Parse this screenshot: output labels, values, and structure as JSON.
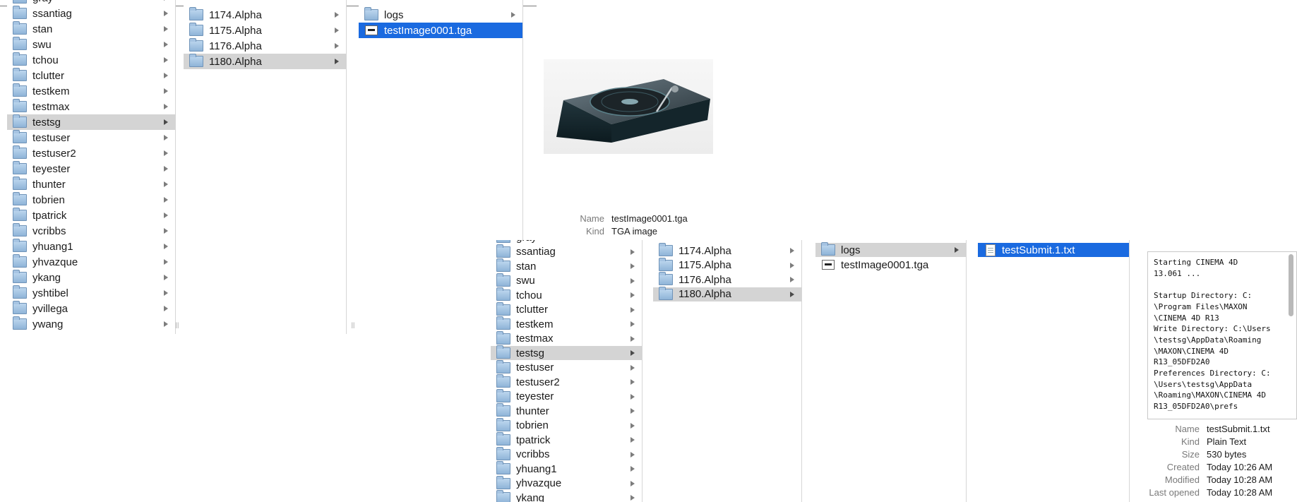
{
  "window_back": {
    "users_column": {
      "items": [
        "gray",
        "ssantiag",
        "stan",
        "swu",
        "tchou",
        "tclutter",
        "testkem",
        "testmax",
        "testsg",
        "testuser",
        "testuser2",
        "teyester",
        "thunter",
        "tobrien",
        "tpatrick",
        "vcribbs",
        "yhuang1",
        "yhvazque",
        "ykang",
        "yshtibel",
        "yvillega",
        "ywang"
      ],
      "selected": "testsg"
    },
    "jobs_column": {
      "items": [
        "1174.Alpha",
        "1175.Alpha",
        "1176.Alpha",
        "1180.Alpha"
      ],
      "selected": "1180.Alpha"
    },
    "files_column": {
      "folder": "logs",
      "file": "testImage0001.tga"
    },
    "preview": {
      "name_label": "Name",
      "name_value": "testImage0001.tga",
      "kind_label": "Kind",
      "kind_value": "TGA image"
    },
    "resize_grip": "||"
  },
  "window_front": {
    "users_column": {
      "items": [
        "gray",
        "ssantiag",
        "stan",
        "swu",
        "tchou",
        "tclutter",
        "testkem",
        "testmax",
        "testsg",
        "testuser",
        "testuser2",
        "teyester",
        "thunter",
        "tobrien",
        "tpatrick",
        "vcribbs",
        "yhuang1",
        "yhvazque",
        "ykang"
      ],
      "selected": "testsg"
    },
    "jobs_column": {
      "items": [
        "1174.Alpha",
        "1175.Alpha",
        "1176.Alpha",
        "1180.Alpha"
      ],
      "selected": "1180.Alpha"
    },
    "files_column": {
      "folder": "logs",
      "file": "testImage0001.tga"
    },
    "logs_column": {
      "file": "testSubmit.1.txt"
    },
    "text_preview": "Starting CINEMA 4D\n13.061 ...\n\nStartup Directory: C:\n\\Program Files\\MAXON\n\\CINEMA 4D R13\nWrite Directory: C:\\Users\n\\testsg\\AppData\\Roaming\n\\MAXON\\CINEMA 4D\nR13_05DFD2A0\nPreferences Directory: C:\n\\Users\\testsg\\AppData\n\\Roaming\\MAXON\\CINEMA 4D\nR13_05DFD2A0\\prefs",
    "info": {
      "name_label": "Name",
      "name_value": "testSubmit.1.txt",
      "kind_label": "Kind",
      "kind_value": "Plain Text",
      "size_label": "Size",
      "size_value": "530 bytes",
      "created_label": "Created",
      "created_value": "Today 10:26 AM",
      "modified_label": "Modified",
      "modified_value": "Today 10:28 AM",
      "opened_label": "Last opened",
      "opened_value": "Today 10:28 AM"
    }
  }
}
